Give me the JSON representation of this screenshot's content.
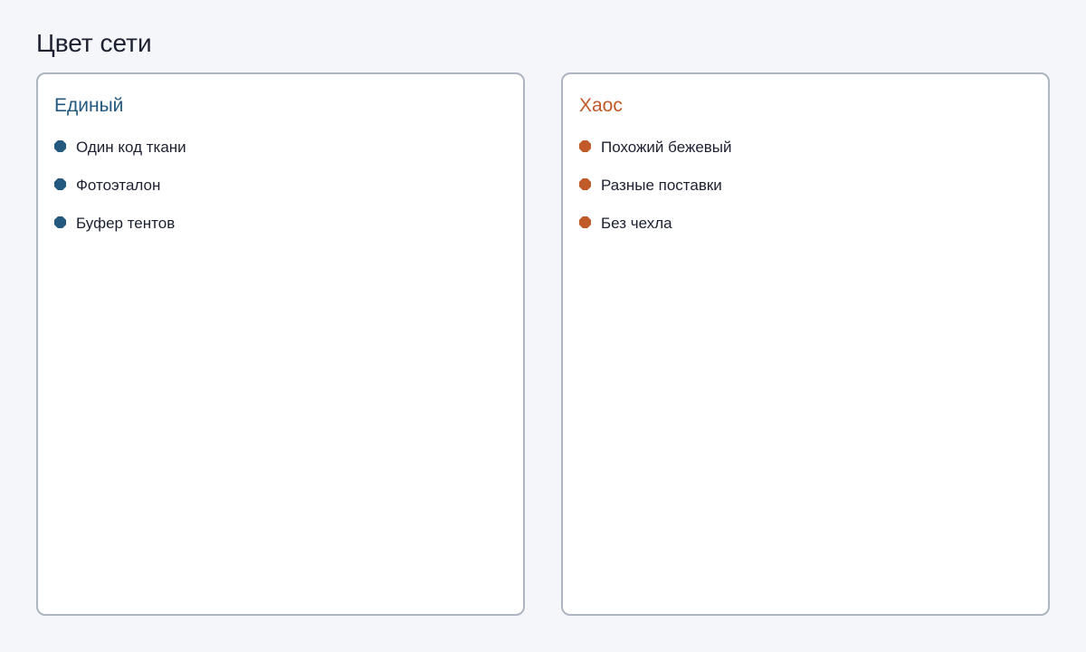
{
  "page": {
    "title": "Цвет сети"
  },
  "cards": [
    {
      "title": "Единый",
      "accent": "#23587f",
      "items": [
        "Один код ткани",
        "Фотоэталон",
        "Буфер тентов"
      ]
    },
    {
      "title": "Хаос",
      "accent": "#c05a28",
      "items": [
        "Похожий бежевый",
        "Разные поставки",
        "Без чехла"
      ]
    }
  ],
  "icons": {
    "bullet": "octagon-bullet-icon"
  }
}
